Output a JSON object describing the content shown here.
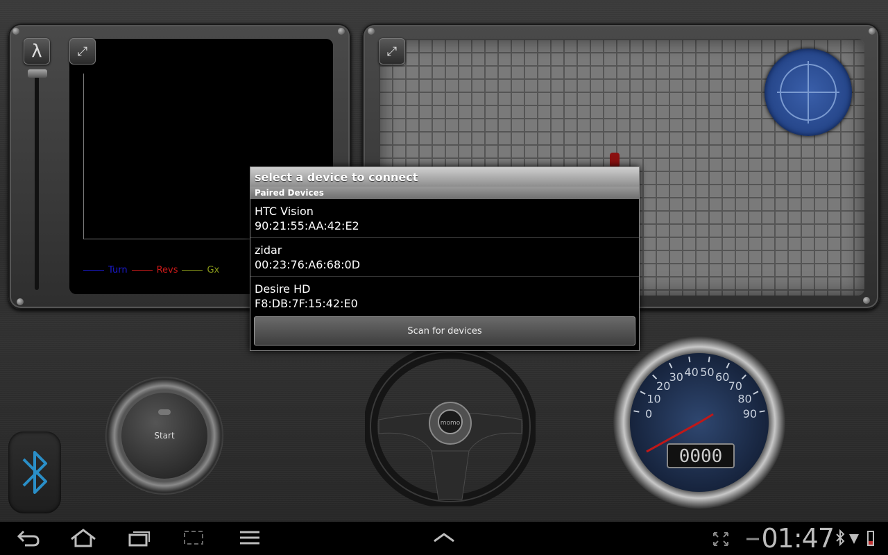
{
  "graph_panel": {
    "lambda_label": "λ",
    "legend": [
      {
        "label": "Turn",
        "color": "#1a1acc"
      },
      {
        "label": "Revs",
        "color": "#cc1a1a"
      },
      {
        "label": "Gx",
        "color": "#8a9a1a"
      }
    ]
  },
  "dialog": {
    "title": "select a device to connect",
    "section": "Paired Devices",
    "devices": [
      {
        "name": "HTC Vision",
        "address": "90:21:55:AA:42:E2"
      },
      {
        "name": "zidar",
        "address": "00:23:76:A6:68:0D"
      },
      {
        "name": "Desire HD",
        "address": "F8:DB:7F:15:42:E0"
      }
    ],
    "scan_label": "Scan for devices"
  },
  "controls": {
    "start_label": "Start",
    "wheel_hub_label": "momo"
  },
  "speedometer": {
    "ticks": [
      "0",
      "10",
      "20",
      "30",
      "40",
      "50",
      "60",
      "70",
      "80",
      "90"
    ],
    "odometer": "0000"
  },
  "statusbar": {
    "time": "01:47",
    "icons": [
      "back-icon",
      "home-icon",
      "recent-apps-icon",
      "screenshot-icon",
      "menu-icon",
      "chevron-up-icon",
      "fullscreen-icon",
      "bluetooth-icon",
      "wifi-icon",
      "battery-icon"
    ]
  },
  "colors": {
    "accent_blue": "#2a8fc8",
    "dialog_header": "#8d8d8d"
  }
}
